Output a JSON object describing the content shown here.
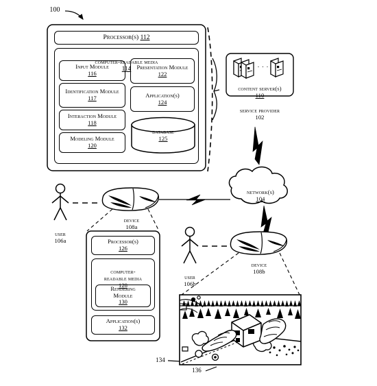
{
  "figure": {
    "ref_100": "100",
    "ref_134": "134",
    "ref_136": "136"
  },
  "system_box": {
    "processor": {
      "label": "Processor(s)",
      "ref": "112"
    },
    "crm": {
      "label": "Computer-Readable Media",
      "ref": "114"
    },
    "modules": [
      {
        "name": "input-module",
        "label": "Input Module",
        "ref": "116"
      },
      {
        "name": "identification-module",
        "label": "Identification Module",
        "ref": "117"
      },
      {
        "name": "interaction-module",
        "label": "Interaction Module",
        "ref": "118"
      },
      {
        "name": "modeling-module",
        "label": "Modeling Module",
        "ref": "120"
      },
      {
        "name": "presentation-module",
        "label": "Presentation Module",
        "ref": "122"
      },
      {
        "name": "applications",
        "label": "Application(s)",
        "ref": "124"
      }
    ],
    "database": {
      "label": "Database",
      "ref": "125"
    }
  },
  "service_provider": {
    "content_servers": {
      "label": "Content Server(s)",
      "ref": "110"
    },
    "caption": {
      "label": "Service Provider",
      "ref": "102"
    },
    "ellipsis": ". . ."
  },
  "network": {
    "label": "Network(s)",
    "ref": "104"
  },
  "user_a": {
    "label": "User",
    "ref": "106A"
  },
  "user_b": {
    "label": "User",
    "ref": "106B"
  },
  "device_a": {
    "label": "Device",
    "ref": "108A"
  },
  "device_b": {
    "label": "Device",
    "ref": "108B"
  },
  "device_box": {
    "processor": {
      "label": "Processor(s)",
      "ref": "126"
    },
    "crm": {
      "label": "Computer-\nReadable Media",
      "ref": "128"
    },
    "rendering_module": {
      "label": "Rendering Module",
      "ref": "130"
    },
    "applications": {
      "label": "Application(s)",
      "ref": "132"
    }
  },
  "scene": {
    "description": "virtual-landscape-with-hands-placing-building"
  },
  "colors": {
    "ink": "#000000",
    "paper": "#ffffff"
  }
}
